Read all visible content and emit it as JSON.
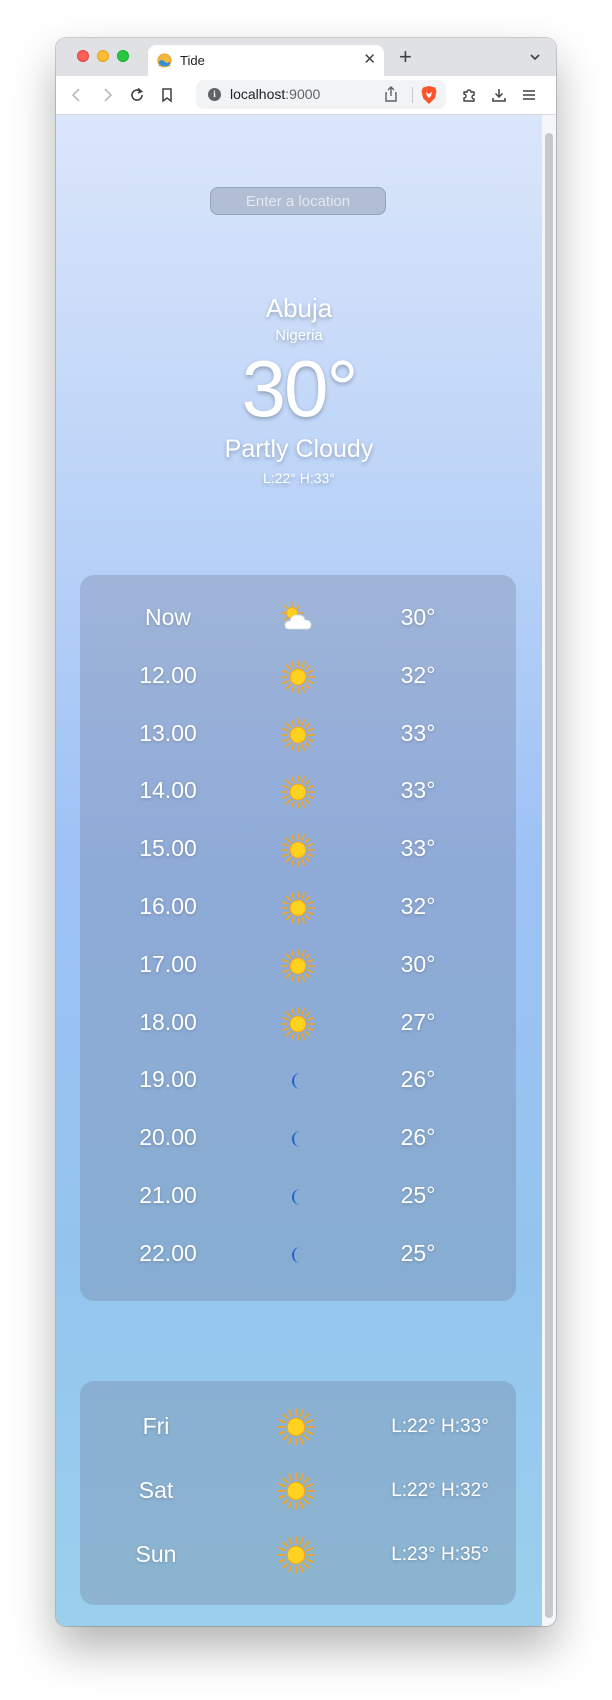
{
  "browser": {
    "tab_title": "Tide",
    "url_host": "localhost",
    "url_port": ":9000"
  },
  "search": {
    "placeholder": "Enter a location"
  },
  "current": {
    "city": "Abuja",
    "country": "Nigeria",
    "temperature": "30°",
    "condition": "Partly Cloudy",
    "low_high": "L:22°  H:33°"
  },
  "hourly": [
    {
      "time": "Now",
      "icon": "partly-cloudy-icon",
      "temp": "30°"
    },
    {
      "time": "12.00",
      "icon": "sun-icon",
      "temp": "32°"
    },
    {
      "time": "13.00",
      "icon": "sun-icon",
      "temp": "33°"
    },
    {
      "time": "14.00",
      "icon": "sun-icon",
      "temp": "33°"
    },
    {
      "time": "15.00",
      "icon": "sun-icon",
      "temp": "33°"
    },
    {
      "time": "16.00",
      "icon": "sun-icon",
      "temp": "32°"
    },
    {
      "time": "17.00",
      "icon": "sun-icon",
      "temp": "30°"
    },
    {
      "time": "18.00",
      "icon": "sun-icon",
      "temp": "27°"
    },
    {
      "time": "19.00",
      "icon": "moon-icon",
      "temp": "26°"
    },
    {
      "time": "20.00",
      "icon": "moon-icon",
      "temp": "26°"
    },
    {
      "time": "21.00",
      "icon": "moon-icon",
      "temp": "25°"
    },
    {
      "time": "22.00",
      "icon": "moon-icon",
      "temp": "25°"
    }
  ],
  "daily": [
    {
      "day": "Fri",
      "icon": "sun-icon",
      "range": "L:22°  H:33°"
    },
    {
      "day": "Sat",
      "icon": "sun-icon",
      "range": "L:22°  H:32°"
    },
    {
      "day": "Sun",
      "icon": "sun-icon",
      "range": "L:23°  H:35°"
    }
  ],
  "colors": {
    "sun": "#ffd21f",
    "sun_rays": "#f7a51c",
    "moon": "#1f5fd1"
  }
}
